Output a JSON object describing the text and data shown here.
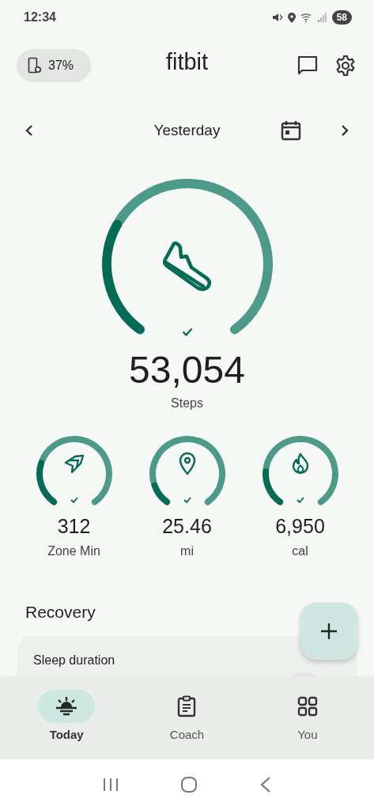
{
  "status_bar": {
    "time": "12:34",
    "battery": "58"
  },
  "header": {
    "device_battery": "37%",
    "title": "fitbit"
  },
  "date_nav": {
    "label": "Yesterday"
  },
  "steps": {
    "value": "53,054",
    "label": "Steps",
    "goal_met": true
  },
  "stats": [
    {
      "kind": "zone",
      "value": "312",
      "label": "Zone Min",
      "goal_met": true
    },
    {
      "kind": "distance",
      "value": "25.46",
      "label": "mi",
      "goal_met": true
    },
    {
      "kind": "calories",
      "value": "6,950",
      "label": "cal",
      "goal_met": true
    }
  ],
  "recovery": {
    "title": "Recovery",
    "cards": [
      {
        "title": "Sleep duration"
      }
    ]
  },
  "bottom_nav": [
    {
      "label": "Today",
      "selected": true
    },
    {
      "label": "Coach",
      "selected": false
    },
    {
      "label": "You",
      "selected": false
    }
  ]
}
